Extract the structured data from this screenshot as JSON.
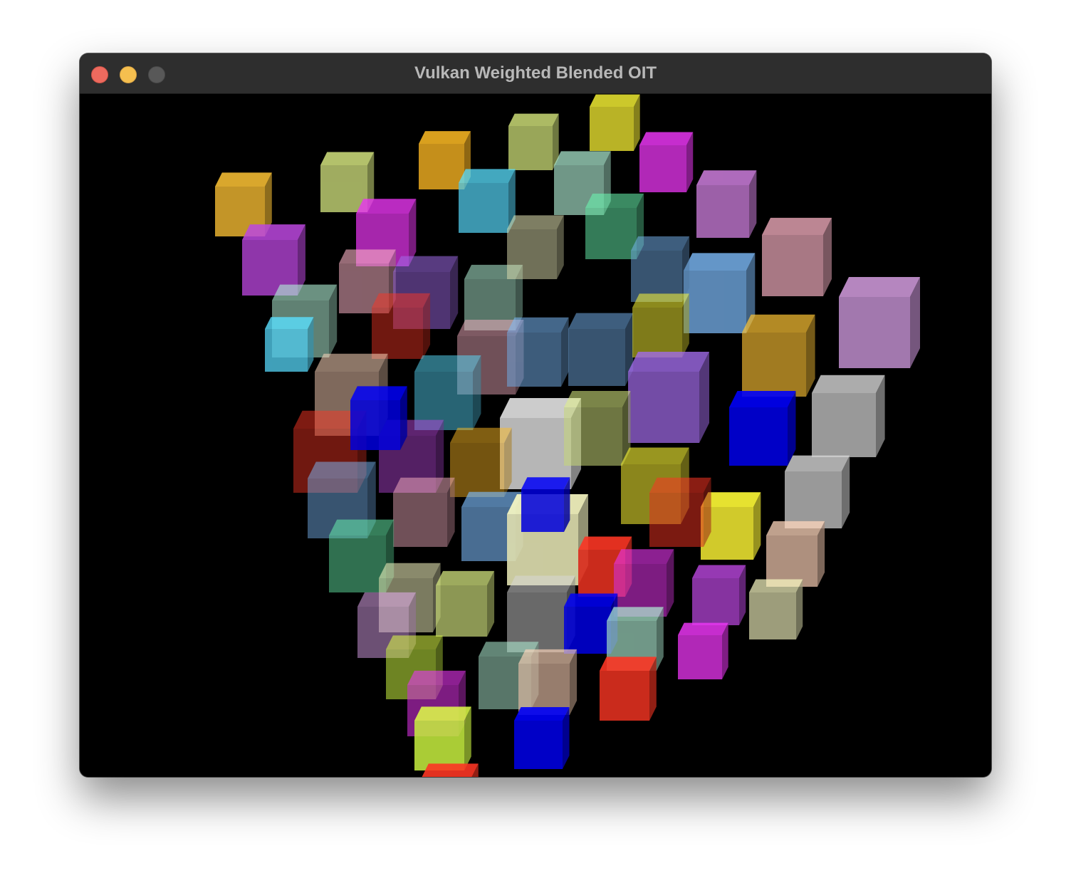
{
  "window": {
    "title": "Vulkan Weighted Blended OIT",
    "traffic_lights": {
      "close_color": "#ed6a5e",
      "minimize_color": "#f5bf4f",
      "zoom_color": "#585858"
    }
  },
  "scene": {
    "background": "#000000",
    "cube_colors": [
      "#e5b030",
      "#c8d878",
      "#e8a820",
      "#c0d070",
      "#e8e030",
      "#d030d8",
      "#d080e0",
      "#e0a0b0",
      "#d8a0e8",
      "#c0c0c0",
      "#0000dd",
      "#50c8e8",
      "#a0d8c0",
      "#e0e0b0",
      "#e03020",
      "#c8f040",
      "#70a8e0",
      "#e8c0a8",
      "#a840c8",
      "#9060d0",
      "#60e0a0"
    ]
  }
}
